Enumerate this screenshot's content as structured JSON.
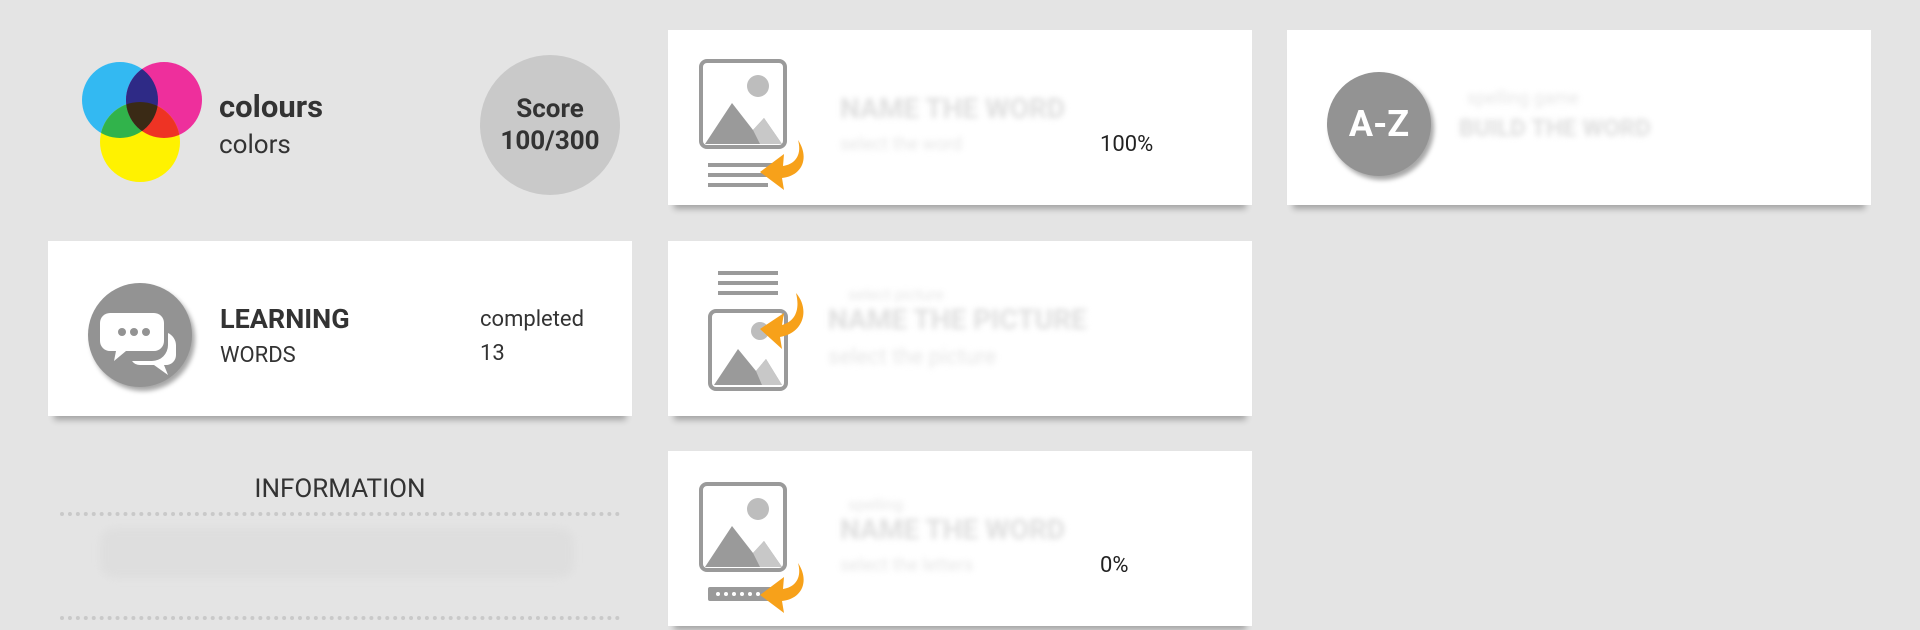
{
  "topic": {
    "title": "colours",
    "subtitle": "colors"
  },
  "score": {
    "label": "Score",
    "value": "100/300"
  },
  "learning": {
    "title": "LEARNING",
    "subtitle": "WORDS",
    "status_label": "completed",
    "count": "13"
  },
  "info": {
    "title": "INFORMATION"
  },
  "games": [
    {
      "percent": "100%"
    },
    {
      "percent": "0%"
    }
  ],
  "az_card": {
    "icon_text": "A-Z"
  },
  "colors": {
    "background": "#e4e4e4",
    "card": "#ffffff",
    "icon_gray": "#939393",
    "arrow_orange": "#f7a11a",
    "score_circle": "#c9c9c9"
  }
}
